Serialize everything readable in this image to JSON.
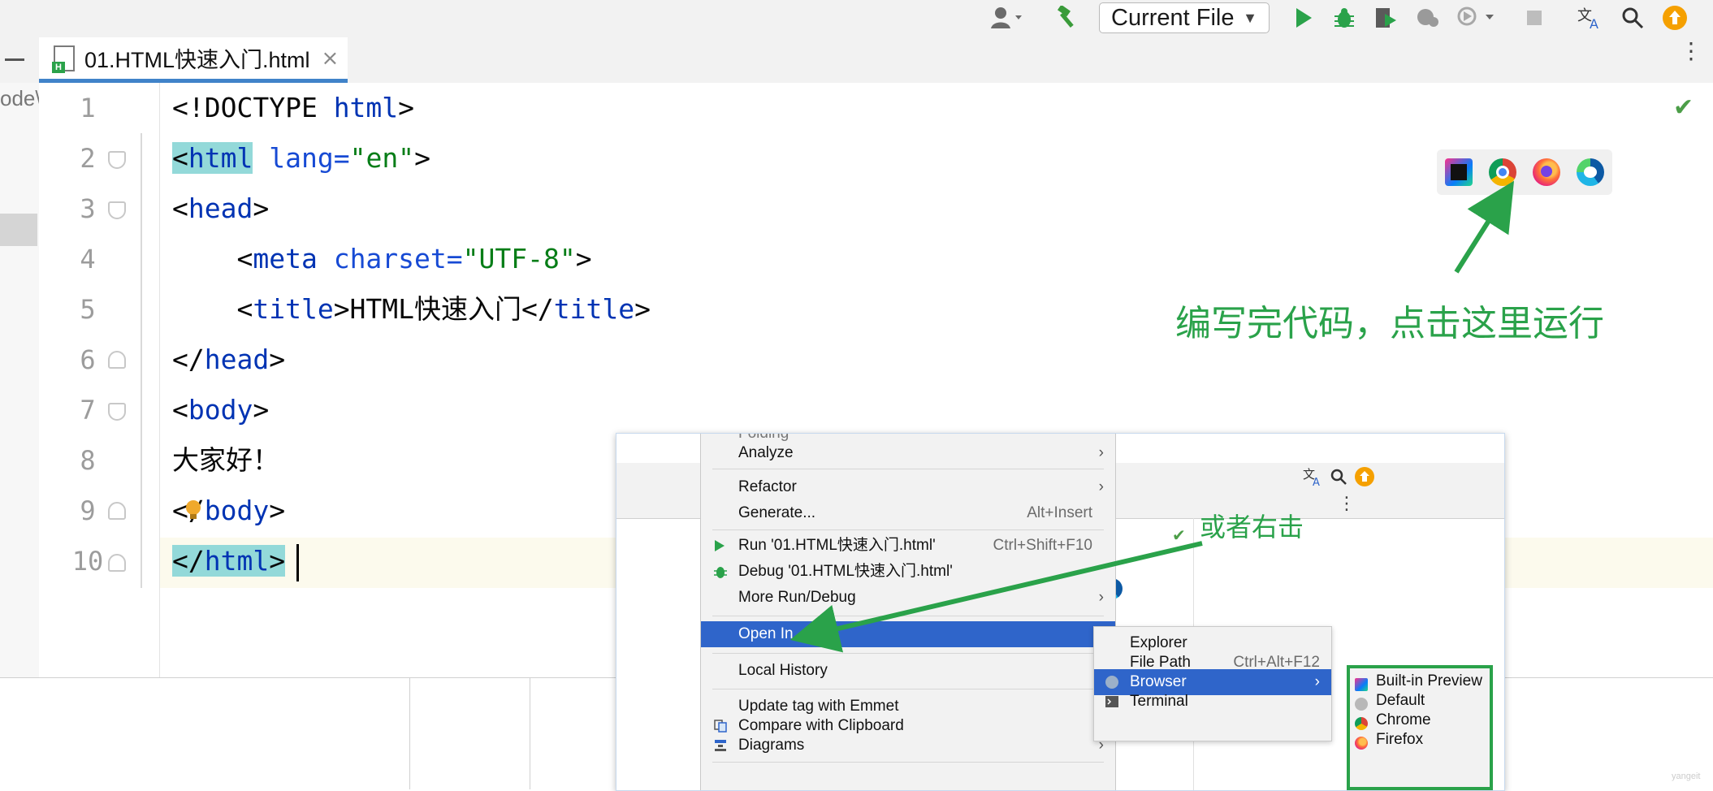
{
  "toolbar": {
    "run_config": "Current File",
    "user_icon": "user-icon",
    "build_icon": "hammer-icon",
    "run_icon": "run-icon",
    "debug_icon": "bug-icon",
    "coverage_icon": "coverage-icon",
    "profile_icon": "profiler-icon",
    "attach_icon": "attach-icon",
    "stop_icon": "stop-icon",
    "translate_icon": "translate-icon",
    "search_icon": "search-icon",
    "update_icon": "update-icon"
  },
  "tab": {
    "label": "01.HTML快速入门.html",
    "close": "×",
    "badge": "H"
  },
  "left_panel": {
    "path_fragment": "ode\\"
  },
  "editor": {
    "lines": [
      {
        "num": "1"
      },
      {
        "num": "2"
      },
      {
        "num": "3"
      },
      {
        "num": "4"
      },
      {
        "num": "5"
      },
      {
        "num": "6"
      },
      {
        "num": "7"
      },
      {
        "num": "8"
      },
      {
        "num": "9"
      },
      {
        "num": "10"
      }
    ],
    "code": {
      "l1a": "<!DOCTYPE ",
      "l1b": "html",
      "l1c": ">",
      "l2a": "<",
      "l2b": "html",
      "l2c": " lang=",
      "l2d": "\"en\"",
      "l2e": ">",
      "l3a": "<",
      "l3b": "head",
      "l3c": ">",
      "l4a": "    <",
      "l4b": "meta",
      "l4c": " charset=",
      "l4d": "\"UTF-8\"",
      "l4e": ">",
      "l5a": "    <",
      "l5b": "title",
      "l5c": ">HTML快速入门</",
      "l5d": "title",
      "l5e": ">",
      "l6a": "</",
      "l6b": "head",
      "l6c": ">",
      "l7a": "<",
      "l7b": "body",
      "l7c": ">",
      "l8a": "大家好！",
      "l9a": "</",
      "l9b": "body",
      "l9c": ">",
      "l10a": "</",
      "l10b": "html",
      "l10c": ">"
    }
  },
  "annotations": {
    "top": "编写完代码，点击这里运行",
    "bottom": "或者右击"
  },
  "context_menu": {
    "folding_partial": "Folding",
    "items": {
      "analyze": "Analyze",
      "refactor": "Refactor",
      "generate": "Generate...",
      "generate_sc": "Alt+Insert",
      "run": "Run '01.HTML快速入门.html'",
      "run_sc": "Ctrl+Shift+F10",
      "debug": "Debug '01.HTML快速入门.html'",
      "more_run": "More Run/Debug",
      "open_in": "Open In",
      "local_history": "Local History",
      "update_tag": "Update tag with Emmet",
      "compare": "Compare with Clipboard",
      "diagrams": "Diagrams"
    },
    "open_in_sub": {
      "explorer": "Explorer",
      "file_path": "File Path",
      "file_path_sc": "Ctrl+Alt+F12",
      "browser": "Browser",
      "terminal": "Terminal"
    },
    "browser_sub": {
      "builtin": "Built-in Preview",
      "default": "Default",
      "chrome": "Chrome",
      "firefox": "Firefox"
    }
  },
  "watermark": "yangeit",
  "colors": {
    "accent": "#2f65ca",
    "annotation": "#2aa24a",
    "run_green": "#2aa24a",
    "tag_blue": "#0033b3",
    "string_green": "#067d17"
  }
}
